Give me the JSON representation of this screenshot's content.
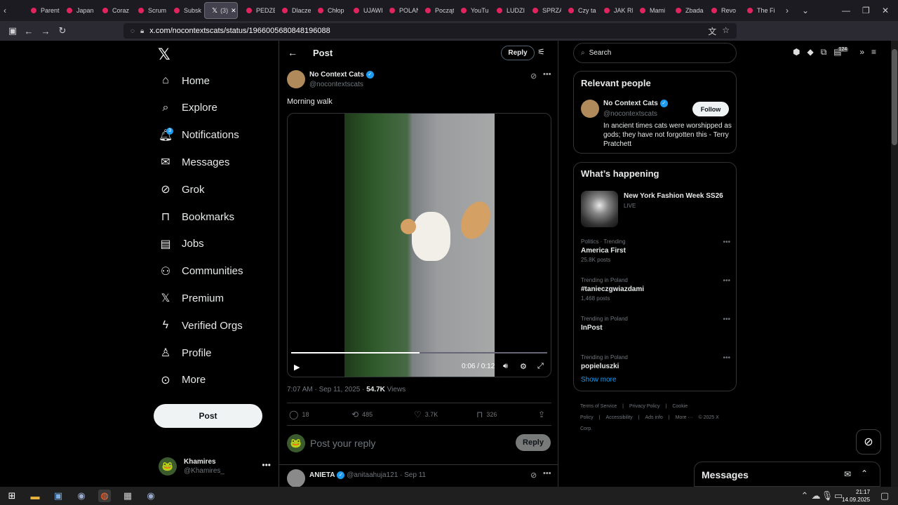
{
  "tabs": [
    "Parenting",
    "Japan",
    "Coraz",
    "Scrum",
    "Subsk",
    "(3)",
    "PEDZĘ",
    "Dlacze",
    "Chłop",
    "UJAWI",
    "POLAŃ",
    "Począt",
    "YouTu",
    "LUDZI",
    "SPRZĄ",
    "Czy ta",
    "JAK RI",
    "Mami",
    "Zbada",
    "Revo",
    "The Fi"
  ],
  "browser": {
    "url": "x.com/nocontextscats/status/1966005680848196088",
    "ext_badge": "124"
  },
  "nav": {
    "items": [
      "Home",
      "Explore",
      "Notifications",
      "Messages",
      "Grok",
      "Bookmarks",
      "Jobs",
      "Communities",
      "Premium",
      "Verified Orgs",
      "Profile",
      "More"
    ],
    "notif_count": "3",
    "post_label": "Post",
    "account_name": "Khamires",
    "account_handle": "@Khamires_"
  },
  "center": {
    "header_title": "Post",
    "reply_header_label": "Reply",
    "author_name": "No Context Cats",
    "author_handle": "@nocontextscats",
    "post_text": "Morning walk",
    "video_time": "0:06 / 0:12",
    "video_progress": 0.5,
    "timestamp": "7:07 AM · Sep 11, 2025 · ",
    "views_count": "54.7K",
    "views_label": " Views",
    "replies": "18",
    "reposts": "485",
    "likes": "3.7K",
    "bookmarks": "326",
    "reply_placeholder": "Post your reply",
    "reply_button": "Reply",
    "comment_name": "ANIETA",
    "comment_meta": "@anitaahuja121 · Sep 11"
  },
  "right": {
    "search_placeholder": "Search",
    "relevant_title": "Relevant people",
    "rp_name": "No Context Cats",
    "rp_handle": "@nocontextscats",
    "follow_label": "Follow",
    "rp_bio": "In ancient times cats were worshipped as gods; they have not forgotten this - Terry Pratchett",
    "happening_title": "What’s happening",
    "featured_title": "New York Fashion Week SS26",
    "featured_status": "LIVE",
    "trends": [
      {
        "category": "Politics · Trending",
        "title": "America First",
        "count": "25.8K posts"
      },
      {
        "category": "Trending in Poland",
        "title": "#tanieczgwiazdami",
        "count": "1,468 posts"
      },
      {
        "category": "Trending in Poland",
        "title": "InPost",
        "count": ""
      },
      {
        "category": "Trending in Poland",
        "title": "popieluszki",
        "count": ""
      }
    ],
    "show_more": "Show more",
    "footer": [
      "Terms of Service",
      "|",
      "Privacy Policy",
      "|",
      "Cookie Policy",
      "|",
      "Accessibility",
      "|",
      "Ads info",
      "|",
      "More ···",
      "© 2025 X Corp."
    ]
  },
  "messages": {
    "title": "Messages"
  },
  "taskbar": {
    "time": "21:17",
    "date": "14.09.2025"
  }
}
